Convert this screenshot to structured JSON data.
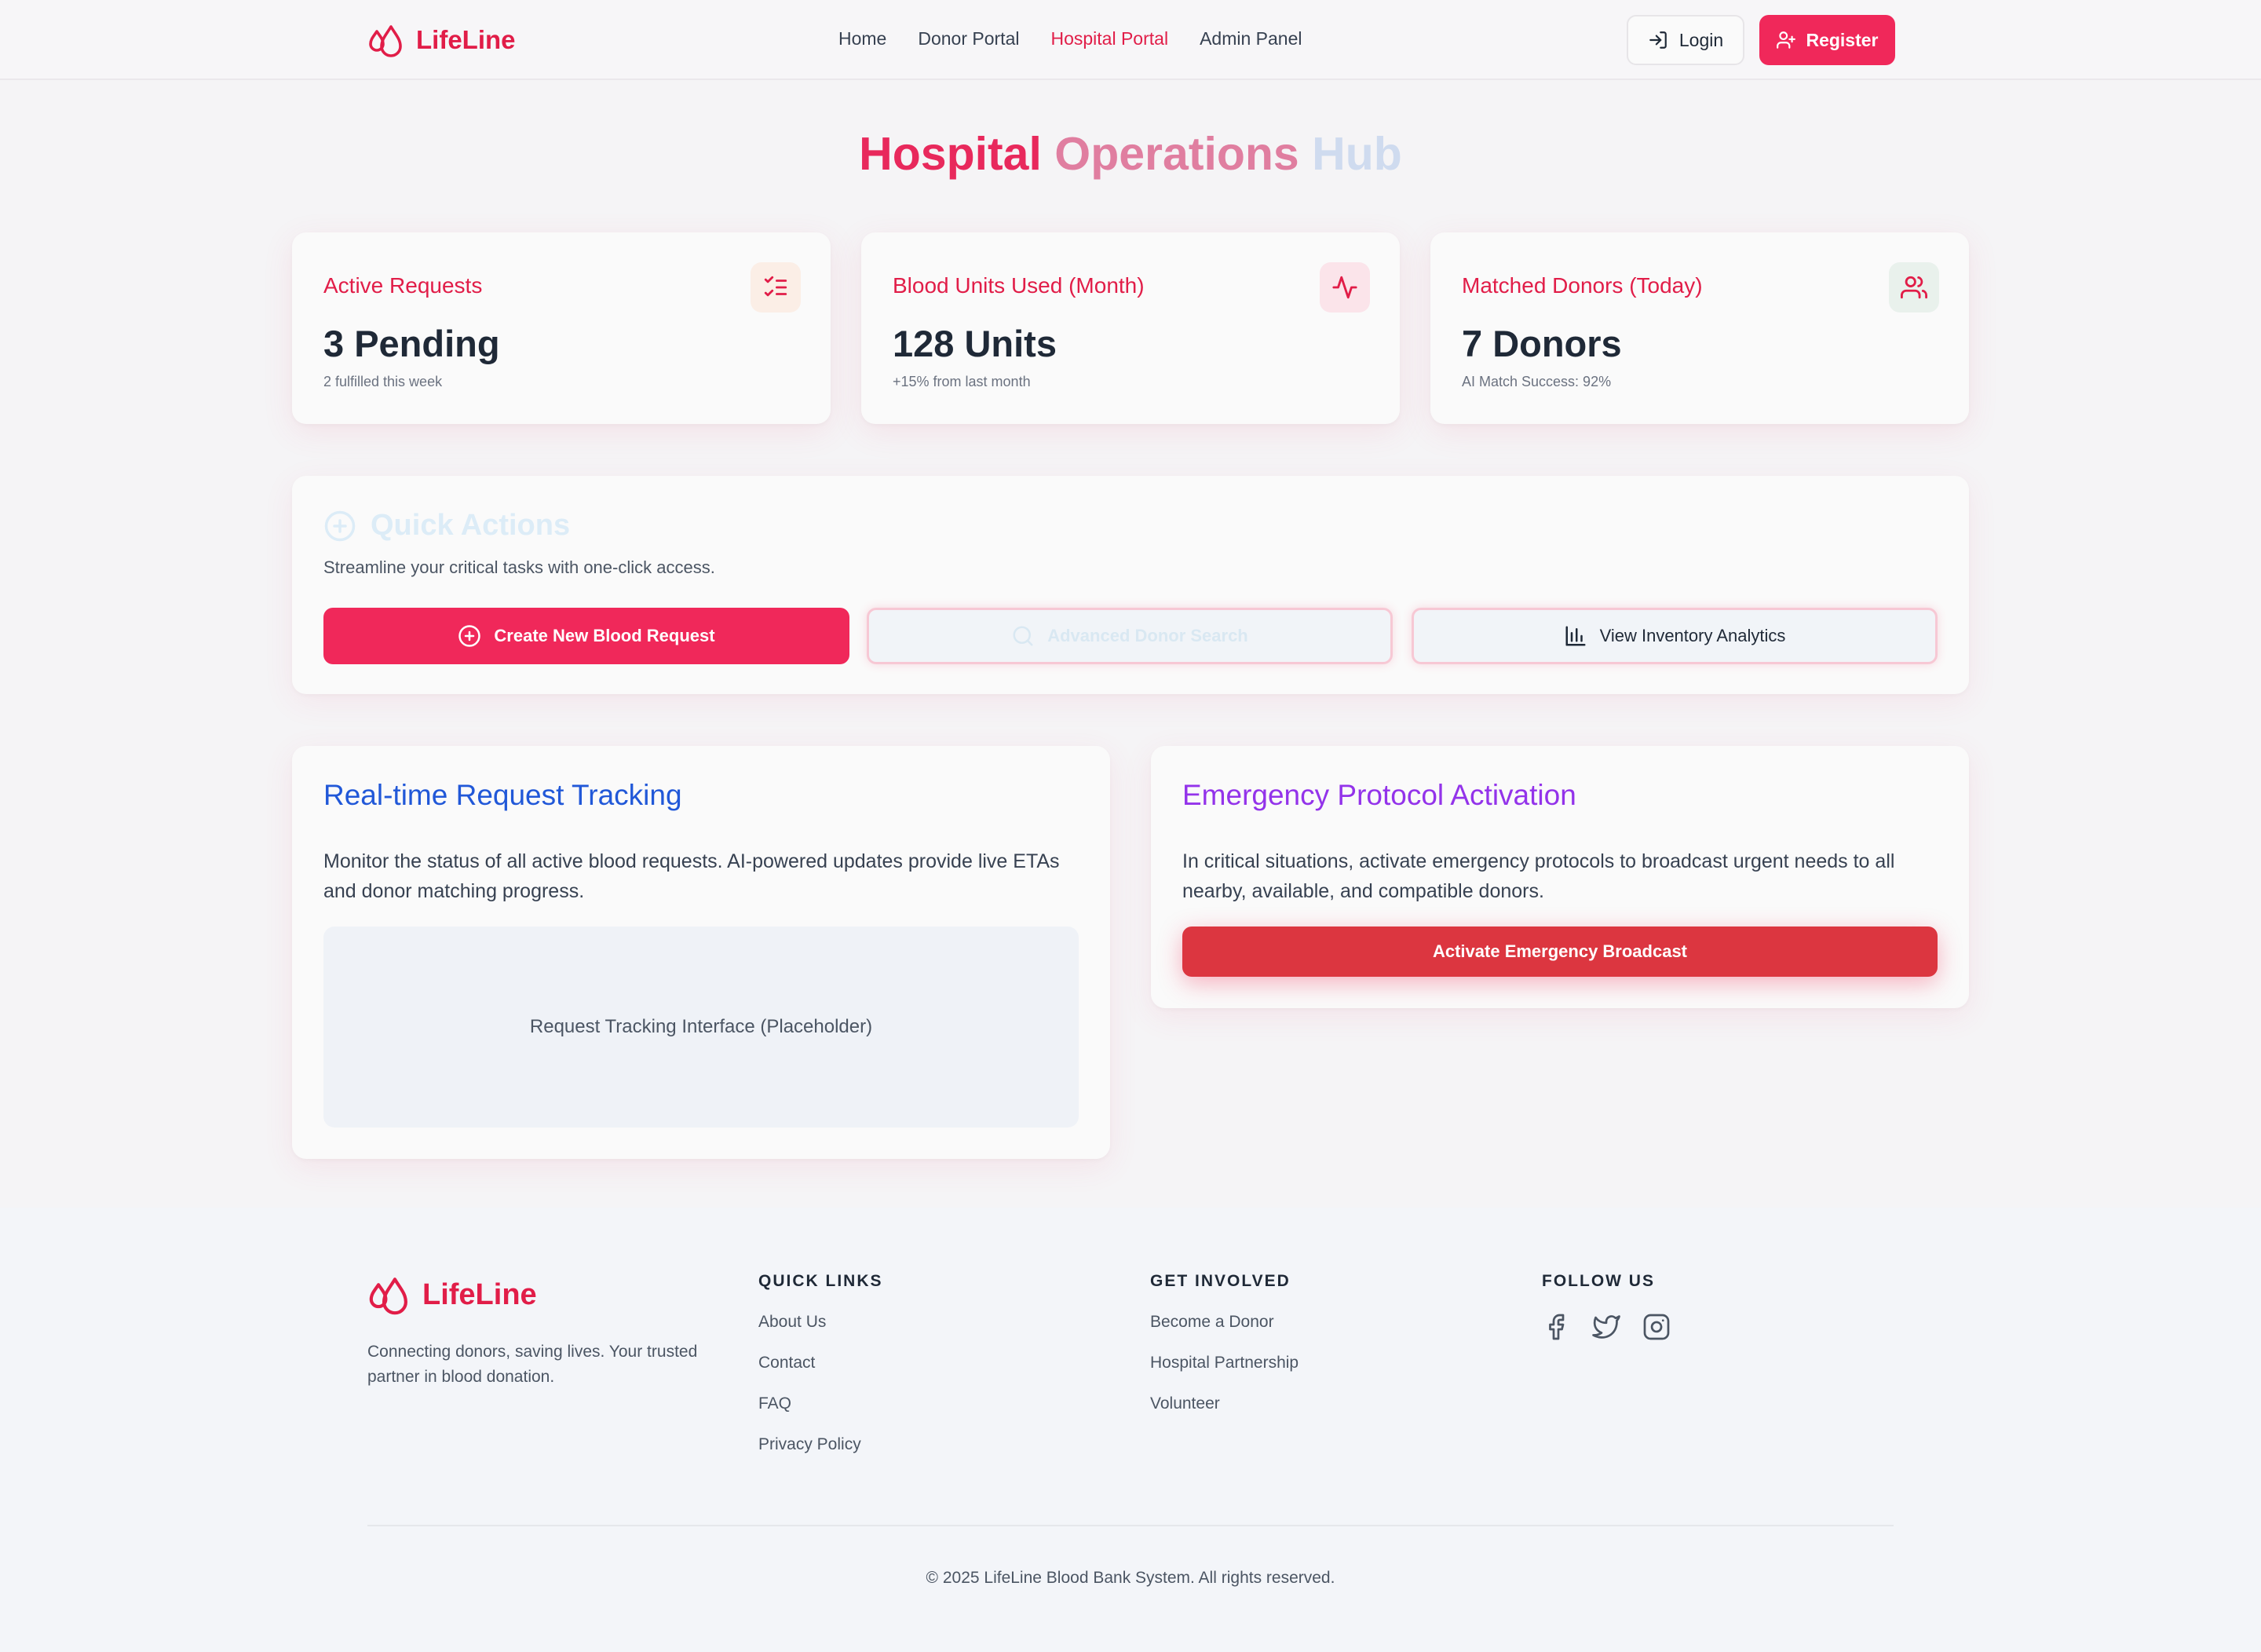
{
  "nav": {
    "brand": "LifeLine",
    "links": [
      "Home",
      "Donor Portal",
      "Hospital Portal",
      "Admin Panel"
    ],
    "active_link": "Hospital Portal",
    "login": "Login",
    "register": "Register"
  },
  "hero": {
    "title_1": "Hospital",
    "title_2": "Operations",
    "title_3": "Hub"
  },
  "stats": [
    {
      "label": "Active Requests",
      "value": "3 Pending",
      "sub": "2 fulfilled this week",
      "icon": "checklist-icon"
    },
    {
      "label": "Blood Units Used (Month)",
      "value": "128 Units",
      "sub": "+15% from last month",
      "icon": "activity-icon"
    },
    {
      "label": "Matched Donors (Today)",
      "value": "7 Donors",
      "sub": "AI Match Success: 92%",
      "icon": "users-icon"
    }
  ],
  "quick_actions": {
    "title": "Quick Actions",
    "subtitle": "Streamline your critical tasks with one-click access.",
    "buttons": [
      "Create New Blood Request",
      "Advanced Donor Search",
      "View Inventory Analytics"
    ]
  },
  "tracking": {
    "title": "Real-time Request Tracking",
    "text": "Monitor the status of all active blood requests. AI-powered updates provide live ETAs and donor matching progress.",
    "placeholder": "Request Tracking Interface (Placeholder)"
  },
  "emergency": {
    "title": "Emergency Protocol Activation",
    "text": "In critical situations, activate emergency protocols to broadcast urgent needs to all nearby, available, and compatible donors.",
    "button": "Activate Emergency Broadcast"
  },
  "footer": {
    "brand": "LifeLine",
    "description": "Connecting donors, saving lives. Your trusted partner in blood donation.",
    "quick_links": {
      "heading": "QUICK LINKS",
      "items": [
        "About Us",
        "Contact",
        "FAQ",
        "Privacy Policy"
      ]
    },
    "get_involved": {
      "heading": "GET INVOLVED",
      "items": [
        "Become a Donor",
        "Hospital Partnership",
        "Volunteer"
      ]
    },
    "follow": {
      "heading": "FOLLOW US",
      "icons": [
        "facebook-icon",
        "twitter-icon",
        "instagram-icon"
      ]
    },
    "copyright": "© 2025 LifeLine Blood Bank System. All rights reserved."
  },
  "colors": {
    "brand": "#e11d48",
    "primary_button": "#f0285a",
    "emergency_button": "#dc3640",
    "tracking_title": "#2158d8",
    "emergency_title": "#9333ea"
  }
}
